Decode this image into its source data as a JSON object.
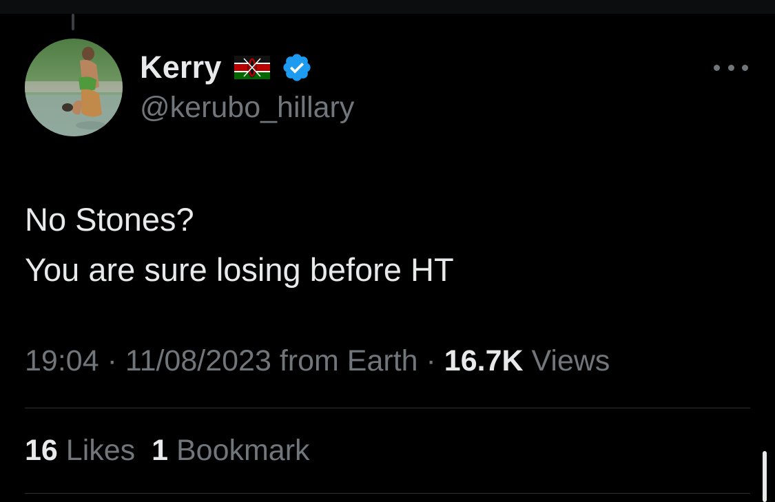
{
  "author": {
    "display_name": "Kerry",
    "handle": "@kerubo_hillary",
    "flag_icon": "kenya-flag-icon",
    "verified_icon": "verified-badge-icon"
  },
  "tweet": {
    "lines": [
      "No Stones?",
      "You are sure losing before HT"
    ]
  },
  "meta": {
    "time": "19:04",
    "separator": "·",
    "date": "11/08/2023",
    "source": "from Earth",
    "views_count": "16.7K",
    "views_label": "Views"
  },
  "engagement": {
    "likes_count": "16",
    "likes_label": "Likes",
    "bookmarks_count": "1",
    "bookmarks_label": "Bookmark"
  },
  "colors": {
    "background": "#000000",
    "primary_text": "#e7e9ea",
    "secondary_text": "#71767b",
    "divider": "#2f3336",
    "verified_blue": "#1d9bf0"
  }
}
